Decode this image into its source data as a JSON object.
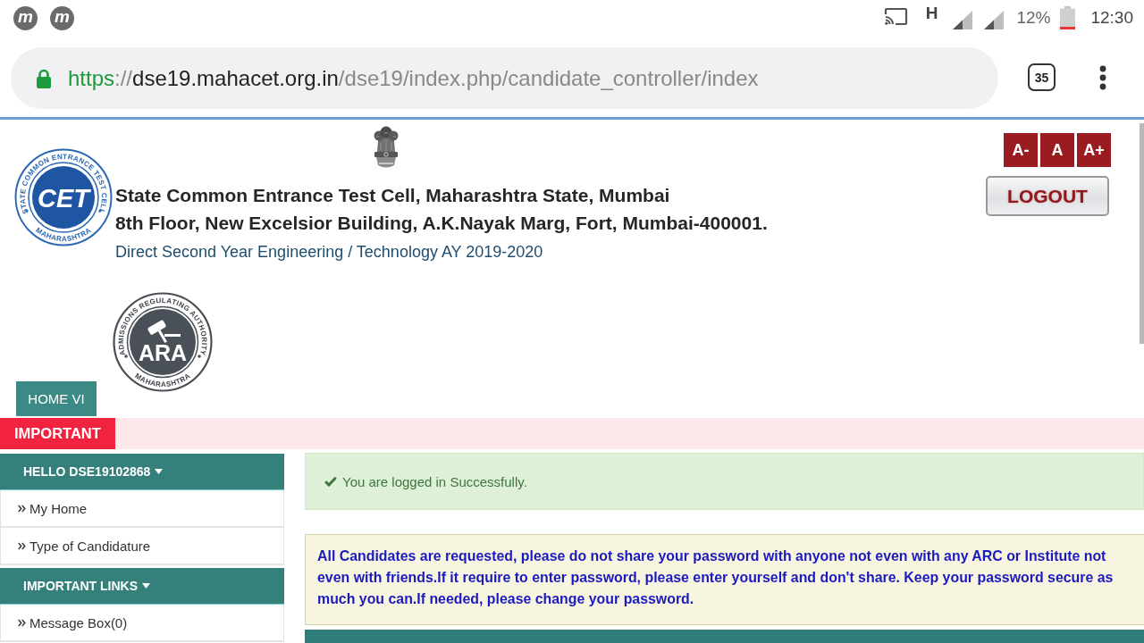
{
  "status_bar": {
    "notification_icons": [
      {
        "glyph": "m"
      },
      {
        "glyph": "m"
      }
    ],
    "network_type": "H",
    "battery_percent": "12%",
    "time": "12:30"
  },
  "browser_toolbar": {
    "address": {
      "scheme": "https",
      "separator": "://",
      "host": "dse19.mahacet.org.in",
      "path": "/dse19/index.php/candidate_controller/index"
    },
    "tab_count": "35"
  },
  "header": {
    "cet_logo": {
      "text": "CET",
      "ring_top": "STATE COMMON ENTRANCE TEST CELL",
      "ring_bottom": "MAHARASHTRA"
    },
    "title_lines": [
      "State Common Entrance Test Cell, Maharashtra State, Mumbai",
      "8th Floor, New Excelsior Building, A.K.Nayak Marg, Fort, Mumbai-400001."
    ],
    "subtitle": "Direct Second Year Engineering / Technology AY 2019-2020",
    "ara_logo": {
      "text": "ARA",
      "ring_top": "ADMISSIONS REGULATING AUTHORITY",
      "ring_bottom": "MAHARASHTRA"
    },
    "font_size_buttons": [
      {
        "label": "A-"
      },
      {
        "label": "A"
      },
      {
        "label": "A+"
      }
    ],
    "logout_button": "LOGOUT"
  },
  "nav": [
    {
      "label": "HOME VI"
    }
  ],
  "important_bar": {
    "label": "IMPORTANT"
  },
  "sidebar": {
    "sections": [
      {
        "title": "HELLO DSE19102868",
        "items": [
          {
            "label": "My Home"
          },
          {
            "label": "Type of Candidature"
          }
        ]
      },
      {
        "title": "IMPORTANT LINKS",
        "items": [
          {
            "label": "Message Box(0)"
          }
        ]
      }
    ]
  },
  "content": {
    "success_alert": "You are logged in Successfully.",
    "notice": "All Candidates are requested, please do not share your password with anyone not even with any ARC or Institute not even with friends.If it require to enter password, please enter yourself and don't share. Keep your password secure as much you can.If needed, please change your password."
  }
}
